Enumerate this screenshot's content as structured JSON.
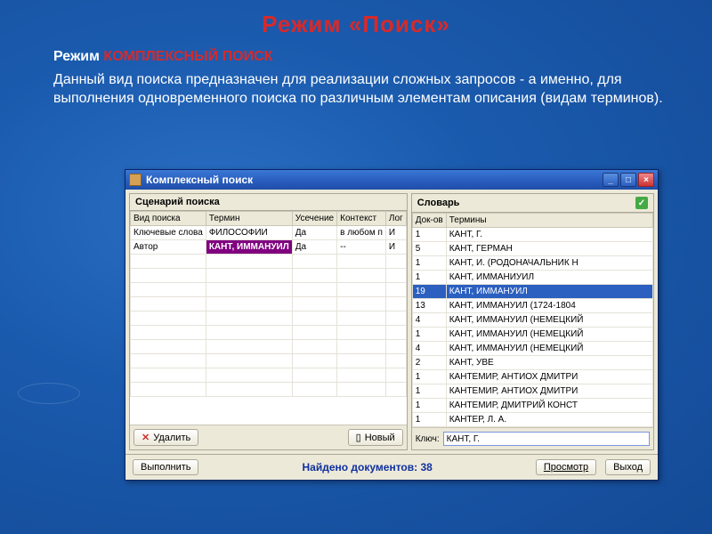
{
  "slide": {
    "title": "Режим  «Поиск»",
    "subtitle_prefix": "Режим ",
    "subtitle_red": "КОМПЛЕКСНЫЙ ПОИСК",
    "paragraph": "Данный вид поиска предназначен для реализации сложных запросов - а именно, для выполнения одновременного поиска по различным элементам описания (видам терминов)."
  },
  "window": {
    "title": "Комплексный поиск",
    "buttons": {
      "min": "_",
      "max": "□",
      "close": "×"
    }
  },
  "scenario": {
    "panel_title": "Сценарий поиска",
    "columns": [
      "Вид поиска",
      "Термин",
      "Усечение",
      "Контекст",
      "Лог"
    ],
    "rows": [
      {
        "type": "Ключевые слова",
        "term": "ФИЛОСОФИИ",
        "trunc": "Да",
        "ctx": "в любом п",
        "log": "И",
        "highlight": false
      },
      {
        "type": "Автор",
        "term": "КАНТ, ИММАНУИЛ",
        "trunc": "Да",
        "ctx": "--",
        "log": "И",
        "highlight": true
      }
    ],
    "empty_rows": 10,
    "delete_label": "Удалить",
    "new_label": "Новый"
  },
  "dictionary": {
    "panel_title": "Словарь",
    "columns": [
      "Док-ов",
      "Термины"
    ],
    "rows": [
      {
        "n": "1",
        "t": "КАНТ, Г."
      },
      {
        "n": "5",
        "t": "КАНТ, ГЕРМАН"
      },
      {
        "n": "1",
        "t": "КАНТ, И. (РОДОНАЧАЛЬНИК Н"
      },
      {
        "n": "1",
        "t": "КАНТ, ИММАНИУИЛ"
      },
      {
        "n": "19",
        "t": "КАНТ, ИММАНУИЛ",
        "sel": true
      },
      {
        "n": "13",
        "t": "КАНТ, ИММАНУИЛ (1724-1804"
      },
      {
        "n": "4",
        "t": "КАНТ, ИММАНУИЛ (НЕМЕЦКИЙ"
      },
      {
        "n": "1",
        "t": "КАНТ, ИММАНУИЛ (НЕМЕЦКИЙ"
      },
      {
        "n": "4",
        "t": "КАНТ, ИММАНУИЛ (НЕМЕЦКИЙ"
      },
      {
        "n": "2",
        "t": "КАНТ, УВЕ"
      },
      {
        "n": "1",
        "t": "КАНТЕМИР, АНТИОХ ДМИТРИ"
      },
      {
        "n": "1",
        "t": "КАНТЕМИР, АНТИОХ ДМИТРИ"
      },
      {
        "n": "1",
        "t": "КАНТЕМИР, ДМИТРИЙ КОНСТ"
      },
      {
        "n": "1",
        "t": "КАНТЕР, Л. А."
      }
    ],
    "key_label": "Ключ:",
    "key_value": "КАНТ, Г."
  },
  "bottom": {
    "execute": "Выполнить",
    "status": "Найдено документов: 38",
    "view": "Просмотр",
    "exit": "Выход"
  }
}
